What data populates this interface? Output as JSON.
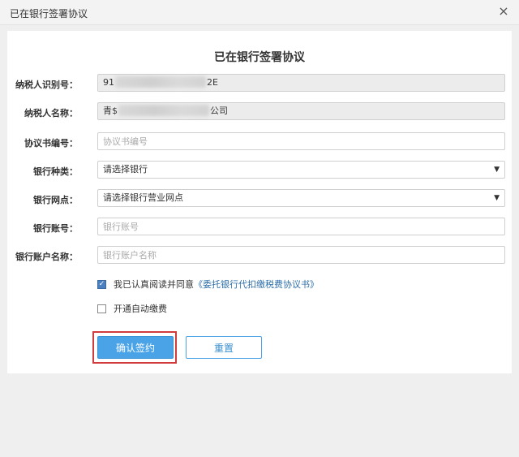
{
  "window": {
    "title": "已在银行签署协议",
    "close_glyph": "×",
    "close_icon": "close-icon"
  },
  "form": {
    "heading": "已在银行签署协议",
    "taxpayer_id": {
      "label": "纳税人识别号：",
      "value_prefix": "91",
      "value_suffix": "2E"
    },
    "taxpayer_name": {
      "label": "纳税人名称：",
      "value_prefix": "青$",
      "value_suffix": "公司"
    },
    "agreement_no": {
      "label": "协议书编号：",
      "placeholder": "协议书编号"
    },
    "bank_type": {
      "label": "银行种类：",
      "selected": "请选择银行"
    },
    "bank_branch": {
      "label": "银行网点：",
      "selected": "请选择银行营业网点"
    },
    "bank_account": {
      "label": "银行账号：",
      "placeholder": "银行账号"
    },
    "account_name": {
      "label": "银行账户名称：",
      "placeholder": "银行账户名称"
    },
    "agree": {
      "checked": true,
      "text": "我已认真阅读并同意",
      "link": "《委托银行代扣缴税费协议书》"
    },
    "auto_pay": {
      "checked": false,
      "text": "开通自动缴费"
    },
    "confirm_label": "确认签约",
    "reset_label": "重置"
  },
  "icons": {
    "caret": "▼",
    "check": "✓"
  },
  "colors": {
    "primary": "#4aa3e6",
    "highlight": "#d23b3b",
    "link": "#2f6fa8"
  }
}
